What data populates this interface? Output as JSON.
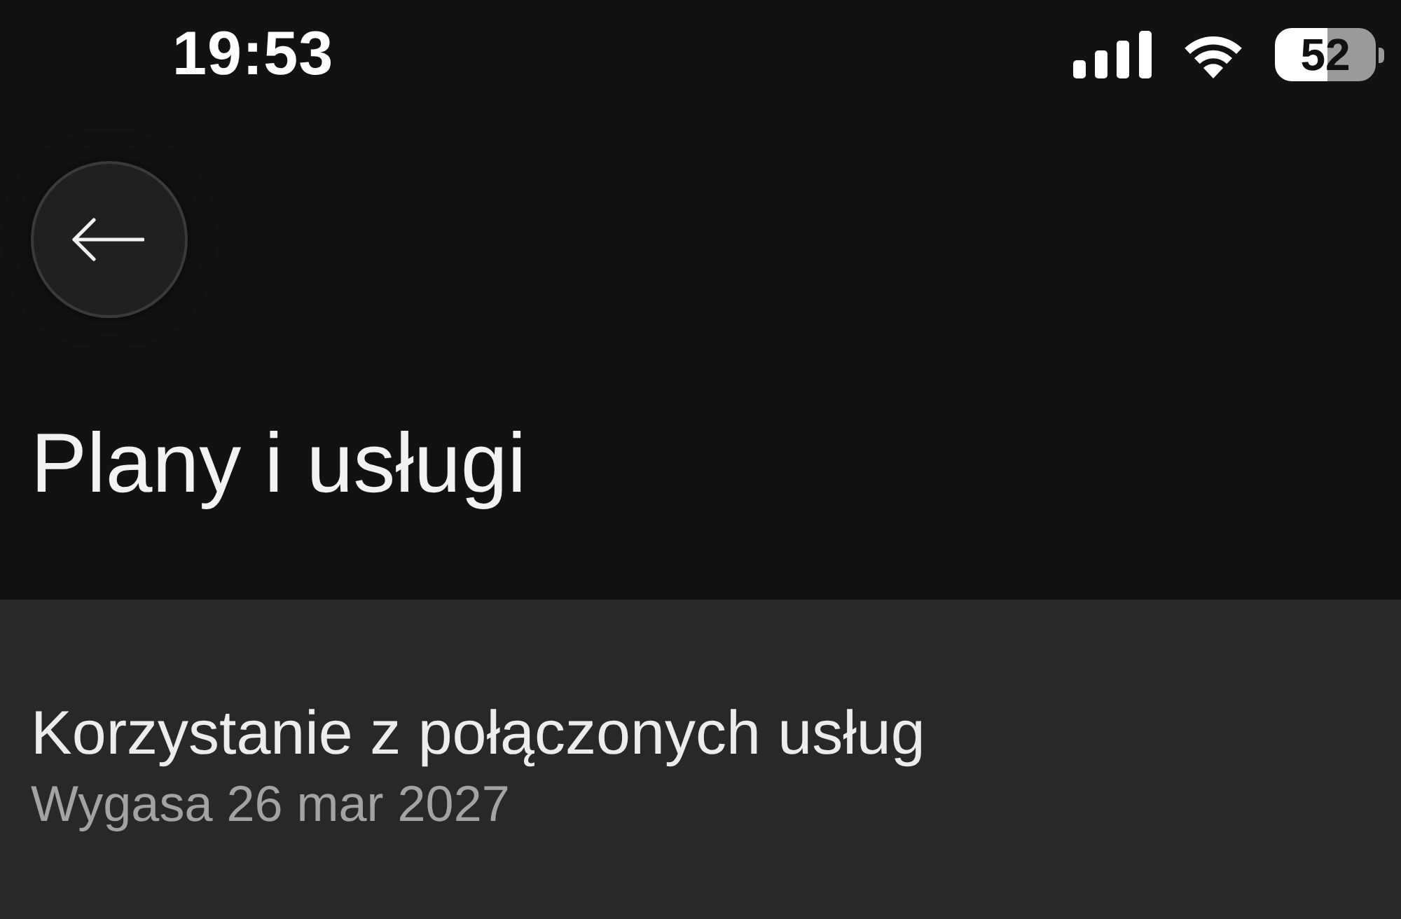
{
  "status_bar": {
    "time": "19:53",
    "battery": "52"
  },
  "header": {
    "title": "Plany i usługi"
  },
  "services": [
    {
      "title": "Korzystanie z połączonych usług",
      "subtitle": "Wygasa 26 mar 2027"
    }
  ]
}
